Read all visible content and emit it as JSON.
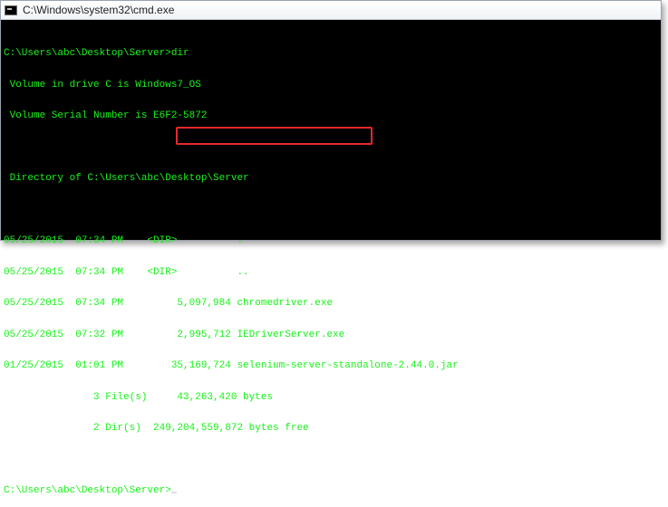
{
  "window": {
    "title": "C:\\Windows\\system32\\cmd.exe",
    "icon": "cmd-prompt-icon"
  },
  "console": {
    "lines": [
      "C:\\Users\\abc\\Desktop\\Server>dir",
      " Volume in drive C is Windows7_OS",
      " Volume Serial Number is E6F2-5872",
      "",
      " Directory of C:\\Users\\abc\\Desktop\\Server",
      "",
      "05/25/2015  07:34 PM    <DIR>          .",
      "05/25/2015  07:34 PM    <DIR>          ..",
      "05/25/2015  07:34 PM         5,097,984 chromedriver.exe",
      "05/25/2015  07:32 PM         2,995,712 IEDriverServer.exe",
      "01/25/2015  01:01 PM        35,169,724 selenium-server-standalone-2.44.0.jar",
      "               3 File(s)     43,263,420 bytes",
      "               2 Dir(s)  249,204,559,872 bytes free",
      "",
      "C:\\Users\\abc\\Desktop\\Server>"
    ]
  },
  "colors": {
    "console_background": "#000000",
    "console_text": "#19f21b",
    "highlight_border": "#e8282b"
  }
}
